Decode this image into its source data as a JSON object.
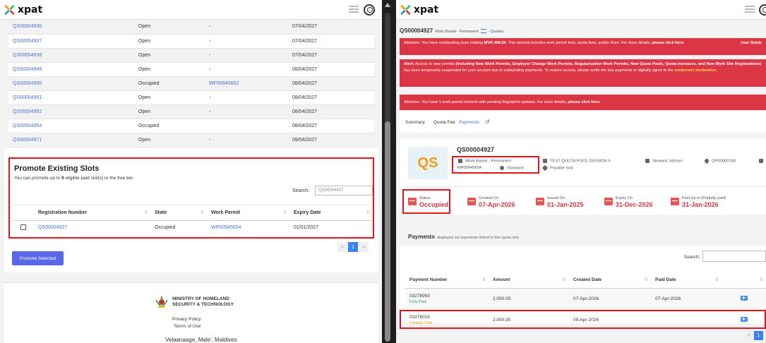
{
  "left": {
    "logo": "xpat",
    "slots": [
      {
        "number": "QS00004936",
        "state": "Open",
        "permit": "-",
        "expiry": "07/04/2027"
      },
      {
        "number": "QS00004937",
        "state": "Open",
        "permit": "-",
        "expiry": "07/04/2027"
      },
      {
        "number": "QS00004938",
        "state": "Open",
        "permit": "-",
        "expiry": "07/04/2027"
      },
      {
        "number": "QS00004949",
        "state": "Open",
        "permit": "-",
        "expiry": "08/04/2027"
      },
      {
        "number": "QS00004950",
        "state": "Occupied",
        "permit": "WP00945652",
        "expiry": "08/04/2027"
      },
      {
        "number": "QS00004951",
        "state": "Open",
        "permit": "-",
        "expiry": "08/04/2027"
      },
      {
        "number": "QS00004952",
        "state": "Open",
        "permit": "-",
        "expiry": "08/04/2027"
      },
      {
        "number": "QS00004954",
        "state": "Occupied",
        "permit": "",
        "expiry": "08/04/2027"
      },
      {
        "number": "QS00004971",
        "state": "Open",
        "permit": "-",
        "expiry": "09/04/2027"
      }
    ],
    "promote": {
      "title": "Promote Existing Slots",
      "subtitle_pre": "You can promote up to ",
      "subtitle_count": "9",
      "subtitle_post": " eligible paid slot(s) to the free tier.",
      "search_label": "Search:",
      "search_value": "QS00004927",
      "headers": [
        "Registration Number",
        "State",
        "Work Permit",
        "Expiry Date"
      ],
      "row": {
        "number": "QS00004927",
        "state": "Occupied",
        "permit": "WP00945654",
        "expiry": "01/01/2027"
      }
    },
    "pager": {
      "prev": "<",
      "page": "1",
      "next": ">"
    },
    "promote_button": "Promote Selected",
    "footer": {
      "ministry_line1": "MINISTRY OF HOMELAND",
      "ministry_line2": "SECURITY & TECHNOLOGY",
      "privacy": "Privacy Policy",
      "terms": "Terms of Use",
      "address": "Velaanaage, Male', Maldives"
    }
  },
  "right": {
    "logo": "xpat",
    "breadcrumb": {
      "id": "QS00004927",
      "type": "Work Based - Permanent",
      "section": "- Quotas"
    },
    "alerts": {
      "dues_pre": "Attention: You have outstanding dues totaling ",
      "dues_amount": "MVR 498.00",
      "dues_mid": ". This amount includes work permit fees, quota fees, and/or fines. For more details, ",
      "dues_link": "please click here.",
      "user_guide": "User Guide",
      "suspend_label": "Alert:",
      "suspend_pre": " Access to new permits ",
      "suspend_bold": "(including New Work Permits, Employer Change Work Permits, Regularization Work Permits, New Quota Pools, Quota Increases, and New Work Site Registrations)",
      "suspend_mid": " has been temporarily suspended for your account due to outstanding payments. To restore access, please settle the due payments or digitally agree to the ",
      "suspend_link": "settlement declaration",
      "suspend_end": ".",
      "finger_pre": "Attention: You have 1 work permit holder/s with pending fingerprint updates. For more details, ",
      "finger_link": "please click here."
    },
    "tabs": [
      "Summary",
      "Quota Fee",
      "Payments"
    ],
    "slot": {
      "avatar": "QS",
      "id": "QS00004927",
      "type": "Work Based - Permanent",
      "permit": "WP00945654",
      "tier": "Standard",
      "pool": "TEST QUOTA POOL DIVISION 5",
      "occupation": "Steward, kitchen",
      "pool_id": "QP00000190",
      "payable": "Payable Slot"
    },
    "stats": [
      {
        "label": "Status",
        "value": "Occupied"
      },
      {
        "label": "Created On",
        "value": "07-Apr-2026"
      },
      {
        "label": "Issued On",
        "value": "01-Jan-2025"
      },
      {
        "label": "Expiry On",
        "value": "31-Dec-2026"
      },
      {
        "label": "Paid Up to (Partially paid)",
        "value": "31-Jan-2026"
      }
    ],
    "payments": {
      "title": "Payments",
      "note": "displayed are payments linked to this quota slot",
      "search_label": "Search:",
      "headers": [
        "Payment Number",
        "Amount",
        "Created Date",
        "Paid Date"
      ],
      "rows": [
        {
          "number": "03276993",
          "status": "Fully Paid",
          "amount": "2,000.00",
          "created": "07-Apr-2026",
          "paid": "07-Apr-2026"
        },
        {
          "number": "03276015",
          "status": "Partially Paid",
          "amount": "2,000.00",
          "created": "09-Apr-2026",
          "paid": ""
        }
      ]
    },
    "pager": {
      "prev": "<",
      "page": "1",
      "next": ">"
    }
  }
}
